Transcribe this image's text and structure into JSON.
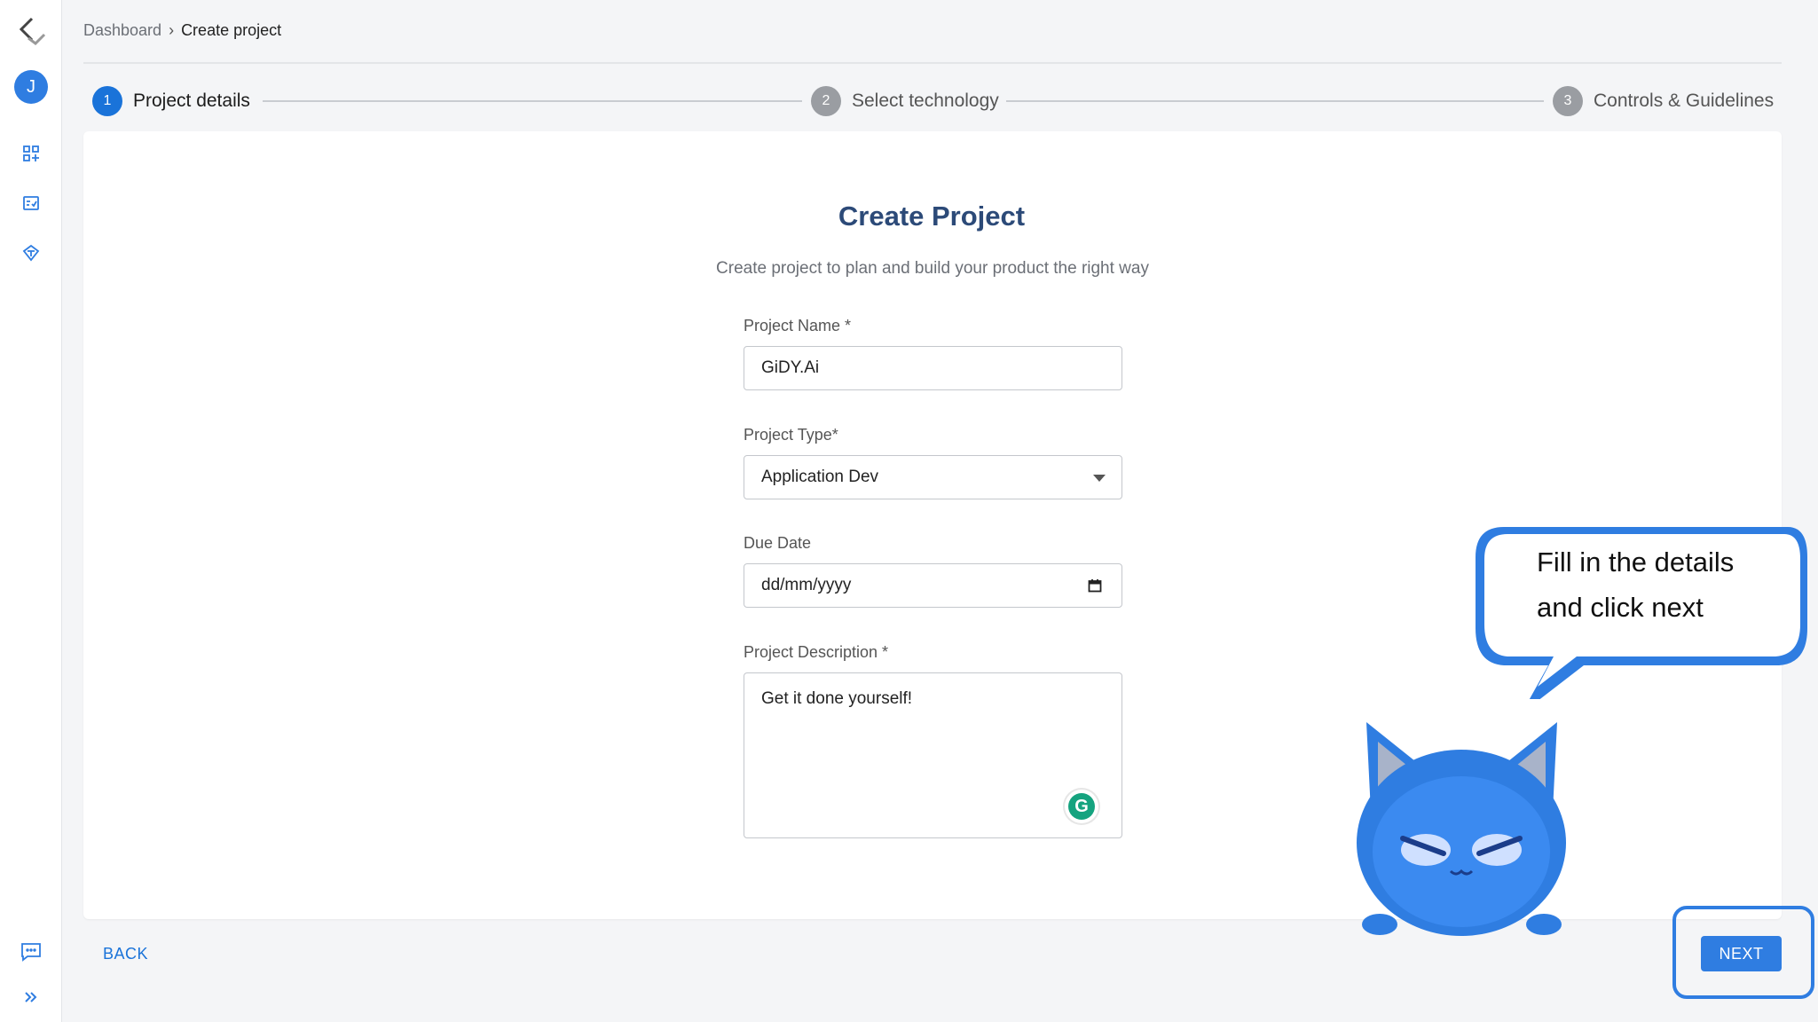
{
  "breadcrumb": {
    "parent": "Dashboard",
    "current": "Create project"
  },
  "sidebar": {
    "avatar_initial": "J",
    "icons": [
      "logo-icon",
      "dashboard-grid-icon",
      "checklist-icon",
      "rocket-icon",
      "chat-icon",
      "expand-icon"
    ]
  },
  "stepper": {
    "steps": [
      {
        "number": "1",
        "label": "Project details",
        "state": "active"
      },
      {
        "number": "2",
        "label": "Select technology",
        "state": "inactive"
      },
      {
        "number": "3",
        "label": "Controls & Guidelines",
        "state": "inactive"
      }
    ]
  },
  "form": {
    "title": "Create Project",
    "subtitle": "Create project to plan and build your product the right way",
    "project_name": {
      "label": "Project Name *",
      "value": "GiDY.Ai"
    },
    "project_type": {
      "label": "Project Type*",
      "value": "Application Dev"
    },
    "due_date": {
      "label": "Due Date",
      "placeholder": "dd/mm/yyyy"
    },
    "description": {
      "label": "Project Description *",
      "value": "Get it done yourself!"
    }
  },
  "actions": {
    "back_label": "BACK",
    "next_label": "NEXT"
  },
  "tooltip": {
    "line1": "Fill in the details",
    "line2": "and click next"
  },
  "colors": {
    "accent": "#2f7de1",
    "title": "#2c4a78",
    "grammarly": "#15a37f"
  }
}
